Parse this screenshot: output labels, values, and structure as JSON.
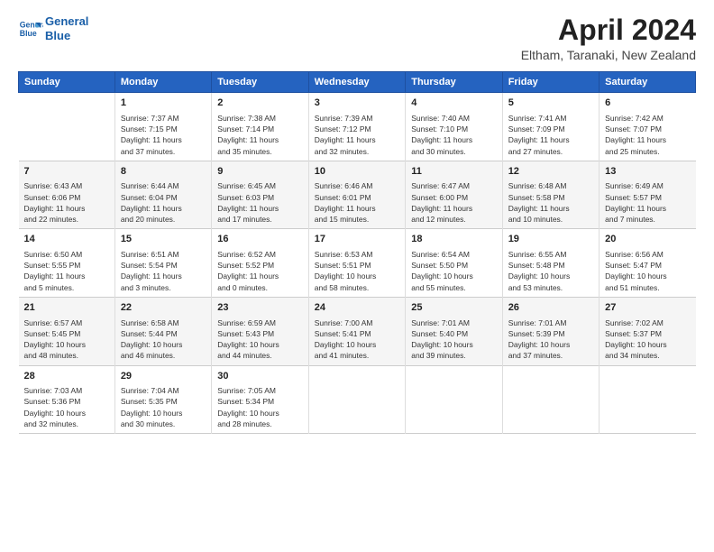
{
  "header": {
    "logo_line1": "General",
    "logo_line2": "Blue",
    "title": "April 2024",
    "location": "Eltham, Taranaki, New Zealand"
  },
  "columns": [
    "Sunday",
    "Monday",
    "Tuesday",
    "Wednesday",
    "Thursday",
    "Friday",
    "Saturday"
  ],
  "weeks": [
    [
      {
        "day": "",
        "info": ""
      },
      {
        "day": "1",
        "info": "Sunrise: 7:37 AM\nSunset: 7:15 PM\nDaylight: 11 hours\nand 37 minutes."
      },
      {
        "day": "2",
        "info": "Sunrise: 7:38 AM\nSunset: 7:14 PM\nDaylight: 11 hours\nand 35 minutes."
      },
      {
        "day": "3",
        "info": "Sunrise: 7:39 AM\nSunset: 7:12 PM\nDaylight: 11 hours\nand 32 minutes."
      },
      {
        "day": "4",
        "info": "Sunrise: 7:40 AM\nSunset: 7:10 PM\nDaylight: 11 hours\nand 30 minutes."
      },
      {
        "day": "5",
        "info": "Sunrise: 7:41 AM\nSunset: 7:09 PM\nDaylight: 11 hours\nand 27 minutes."
      },
      {
        "day": "6",
        "info": "Sunrise: 7:42 AM\nSunset: 7:07 PM\nDaylight: 11 hours\nand 25 minutes."
      }
    ],
    [
      {
        "day": "7",
        "info": "Sunrise: 6:43 AM\nSunset: 6:06 PM\nDaylight: 11 hours\nand 22 minutes."
      },
      {
        "day": "8",
        "info": "Sunrise: 6:44 AM\nSunset: 6:04 PM\nDaylight: 11 hours\nand 20 minutes."
      },
      {
        "day": "9",
        "info": "Sunrise: 6:45 AM\nSunset: 6:03 PM\nDaylight: 11 hours\nand 17 minutes."
      },
      {
        "day": "10",
        "info": "Sunrise: 6:46 AM\nSunset: 6:01 PM\nDaylight: 11 hours\nand 15 minutes."
      },
      {
        "day": "11",
        "info": "Sunrise: 6:47 AM\nSunset: 6:00 PM\nDaylight: 11 hours\nand 12 minutes."
      },
      {
        "day": "12",
        "info": "Sunrise: 6:48 AM\nSunset: 5:58 PM\nDaylight: 11 hours\nand 10 minutes."
      },
      {
        "day": "13",
        "info": "Sunrise: 6:49 AM\nSunset: 5:57 PM\nDaylight: 11 hours\nand 7 minutes."
      }
    ],
    [
      {
        "day": "14",
        "info": "Sunrise: 6:50 AM\nSunset: 5:55 PM\nDaylight: 11 hours\nand 5 minutes."
      },
      {
        "day": "15",
        "info": "Sunrise: 6:51 AM\nSunset: 5:54 PM\nDaylight: 11 hours\nand 3 minutes."
      },
      {
        "day": "16",
        "info": "Sunrise: 6:52 AM\nSunset: 5:52 PM\nDaylight: 11 hours\nand 0 minutes."
      },
      {
        "day": "17",
        "info": "Sunrise: 6:53 AM\nSunset: 5:51 PM\nDaylight: 10 hours\nand 58 minutes."
      },
      {
        "day": "18",
        "info": "Sunrise: 6:54 AM\nSunset: 5:50 PM\nDaylight: 10 hours\nand 55 minutes."
      },
      {
        "day": "19",
        "info": "Sunrise: 6:55 AM\nSunset: 5:48 PM\nDaylight: 10 hours\nand 53 minutes."
      },
      {
        "day": "20",
        "info": "Sunrise: 6:56 AM\nSunset: 5:47 PM\nDaylight: 10 hours\nand 51 minutes."
      }
    ],
    [
      {
        "day": "21",
        "info": "Sunrise: 6:57 AM\nSunset: 5:45 PM\nDaylight: 10 hours\nand 48 minutes."
      },
      {
        "day": "22",
        "info": "Sunrise: 6:58 AM\nSunset: 5:44 PM\nDaylight: 10 hours\nand 46 minutes."
      },
      {
        "day": "23",
        "info": "Sunrise: 6:59 AM\nSunset: 5:43 PM\nDaylight: 10 hours\nand 44 minutes."
      },
      {
        "day": "24",
        "info": "Sunrise: 7:00 AM\nSunset: 5:41 PM\nDaylight: 10 hours\nand 41 minutes."
      },
      {
        "day": "25",
        "info": "Sunrise: 7:01 AM\nSunset: 5:40 PM\nDaylight: 10 hours\nand 39 minutes."
      },
      {
        "day": "26",
        "info": "Sunrise: 7:01 AM\nSunset: 5:39 PM\nDaylight: 10 hours\nand 37 minutes."
      },
      {
        "day": "27",
        "info": "Sunrise: 7:02 AM\nSunset: 5:37 PM\nDaylight: 10 hours\nand 34 minutes."
      }
    ],
    [
      {
        "day": "28",
        "info": "Sunrise: 7:03 AM\nSunset: 5:36 PM\nDaylight: 10 hours\nand 32 minutes."
      },
      {
        "day": "29",
        "info": "Sunrise: 7:04 AM\nSunset: 5:35 PM\nDaylight: 10 hours\nand 30 minutes."
      },
      {
        "day": "30",
        "info": "Sunrise: 7:05 AM\nSunset: 5:34 PM\nDaylight: 10 hours\nand 28 minutes."
      },
      {
        "day": "",
        "info": ""
      },
      {
        "day": "",
        "info": ""
      },
      {
        "day": "",
        "info": ""
      },
      {
        "day": "",
        "info": ""
      }
    ]
  ]
}
